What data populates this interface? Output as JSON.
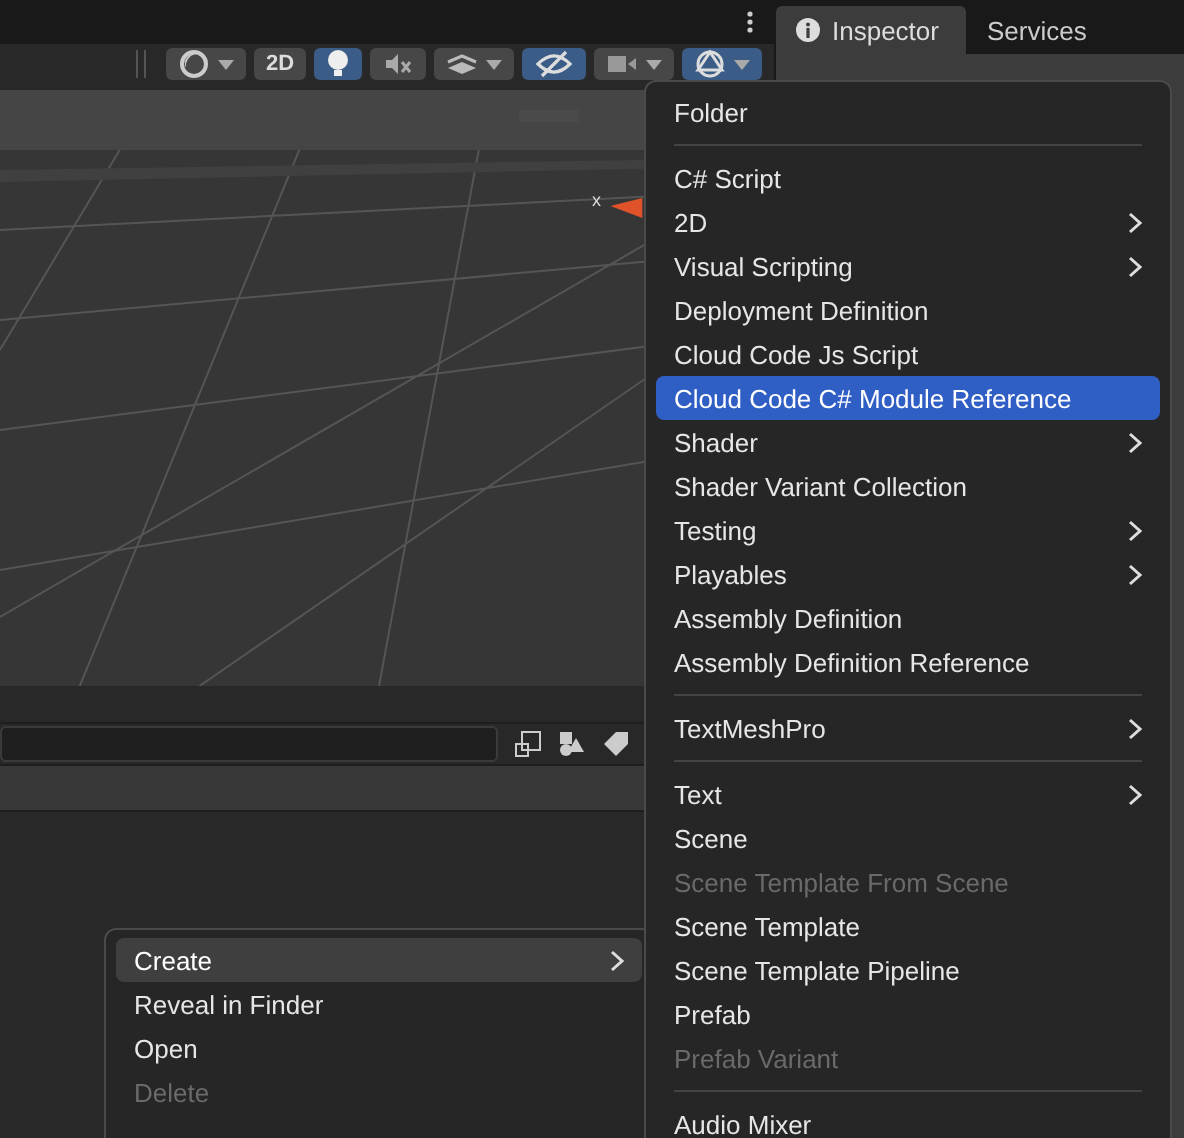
{
  "toolbar": [
    {
      "kind": "draw-mode",
      "dropdown": true,
      "on": false
    },
    {
      "kind": "dimension",
      "label": "2D",
      "dropdown": false,
      "on": false
    },
    {
      "kind": "light",
      "dropdown": false,
      "on": true
    },
    {
      "kind": "audio",
      "dropdown": false,
      "on": false
    },
    {
      "kind": "effects",
      "dropdown": true,
      "on": false
    },
    {
      "kind": "visibility",
      "dropdown": false,
      "on": true
    },
    {
      "kind": "camera",
      "dropdown": true,
      "on": false
    },
    {
      "kind": "gizmos",
      "dropdown": true,
      "on": true
    }
  ],
  "scene_view": {
    "axis_label": "x"
  },
  "tabs": [
    {
      "label": "Inspector",
      "selected": true
    },
    {
      "label": "Services",
      "selected": false
    }
  ],
  "context_menu": [
    {
      "kind": "item",
      "label": "Create",
      "selected": true,
      "disabled": false,
      "submenu": true
    },
    {
      "kind": "item",
      "label": "Reveal in Finder",
      "selected": false,
      "disabled": false,
      "submenu": false
    },
    {
      "kind": "item",
      "label": "Open",
      "selected": false,
      "disabled": false,
      "submenu": false
    },
    {
      "kind": "item",
      "label": "Delete",
      "selected": false,
      "disabled": true,
      "submenu": false
    }
  ],
  "create_menu": [
    {
      "kind": "item",
      "label": "Folder",
      "selected": false,
      "disabled": false,
      "submenu": false
    },
    {
      "kind": "separator"
    },
    {
      "kind": "item",
      "label": "C# Script",
      "selected": false,
      "disabled": false,
      "submenu": false
    },
    {
      "kind": "item",
      "label": "2D",
      "selected": false,
      "disabled": false,
      "submenu": true
    },
    {
      "kind": "item",
      "label": "Visual Scripting",
      "selected": false,
      "disabled": false,
      "submenu": true
    },
    {
      "kind": "item",
      "label": "Deployment Definition",
      "selected": false,
      "disabled": false,
      "submenu": false
    },
    {
      "kind": "item",
      "label": "Cloud Code Js Script",
      "selected": false,
      "disabled": false,
      "submenu": false
    },
    {
      "kind": "item",
      "label": "Cloud Code C# Module Reference",
      "selected": true,
      "disabled": false,
      "submenu": false
    },
    {
      "kind": "item",
      "label": "Shader",
      "selected": false,
      "disabled": false,
      "submenu": true
    },
    {
      "kind": "item",
      "label": "Shader Variant Collection",
      "selected": false,
      "disabled": false,
      "submenu": false
    },
    {
      "kind": "item",
      "label": "Testing",
      "selected": false,
      "disabled": false,
      "submenu": true
    },
    {
      "kind": "item",
      "label": "Playables",
      "selected": false,
      "disabled": false,
      "submenu": true
    },
    {
      "kind": "item",
      "label": "Assembly Definition",
      "selected": false,
      "disabled": false,
      "submenu": false
    },
    {
      "kind": "item",
      "label": "Assembly Definition Reference",
      "selected": false,
      "disabled": false,
      "submenu": false
    },
    {
      "kind": "separator"
    },
    {
      "kind": "item",
      "label": "TextMeshPro",
      "selected": false,
      "disabled": false,
      "submenu": true
    },
    {
      "kind": "separator"
    },
    {
      "kind": "item",
      "label": "Text",
      "selected": false,
      "disabled": false,
      "submenu": true
    },
    {
      "kind": "item",
      "label": "Scene",
      "selected": false,
      "disabled": false,
      "submenu": false
    },
    {
      "kind": "item",
      "label": "Scene Template From Scene",
      "selected": false,
      "disabled": true,
      "submenu": false
    },
    {
      "kind": "item",
      "label": "Scene Template",
      "selected": false,
      "disabled": false,
      "submenu": false
    },
    {
      "kind": "item",
      "label": "Scene Template Pipeline",
      "selected": false,
      "disabled": false,
      "submenu": false
    },
    {
      "kind": "item",
      "label": "Prefab",
      "selected": false,
      "disabled": false,
      "submenu": false
    },
    {
      "kind": "item",
      "label": "Prefab Variant",
      "selected": false,
      "disabled": true,
      "submenu": false
    },
    {
      "kind": "separator"
    },
    {
      "kind": "item",
      "label": "Audio Mixer",
      "selected": false,
      "disabled": false,
      "submenu": false
    }
  ]
}
